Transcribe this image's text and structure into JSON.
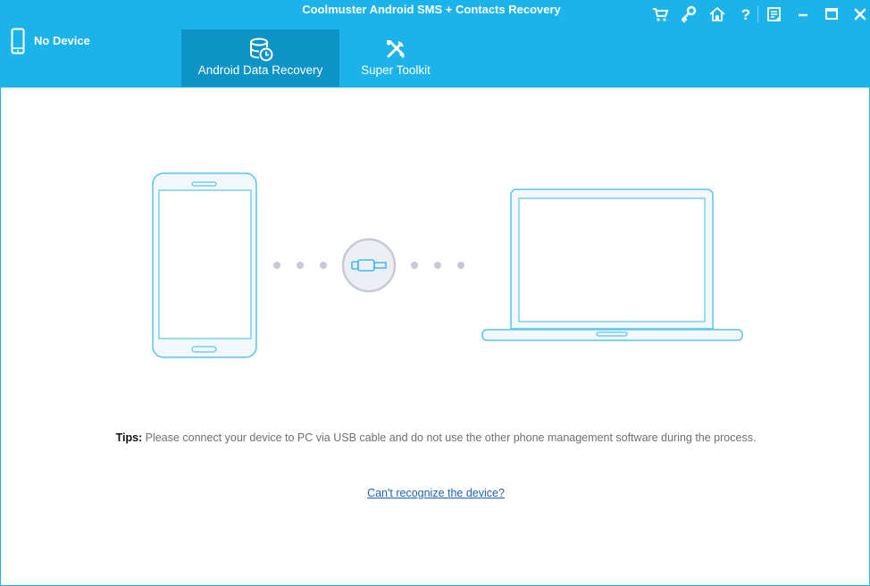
{
  "app": {
    "title": "Coolmuster Android SMS + Contacts Recovery"
  },
  "device": {
    "status": "No Device",
    "icon": "phone-icon"
  },
  "tabs": [
    {
      "label": "Android Data Recovery",
      "icon": "database-clock-icon",
      "active": true
    },
    {
      "label": "Super Toolkit",
      "icon": "tools-icon",
      "active": false
    }
  ],
  "window_controls": [
    "cart-icon",
    "key-icon",
    "home-icon",
    "help-icon",
    "feedback-icon",
    "minimize-icon",
    "maximize-icon",
    "close-icon"
  ],
  "main": {
    "tips_label": "Tips:",
    "tips_text": " Please connect your device to PC via USB cable and do not use the other phone management software during the process.",
    "help_link": "Can't recognize the device?"
  },
  "colors": {
    "header_bg": "#1cb3ea",
    "active_tab_bg": "#0d93c6",
    "illustration_stroke": "#5bc4ec",
    "illustration_fill": "#f1f9fd",
    "link": "#1e63b4"
  }
}
